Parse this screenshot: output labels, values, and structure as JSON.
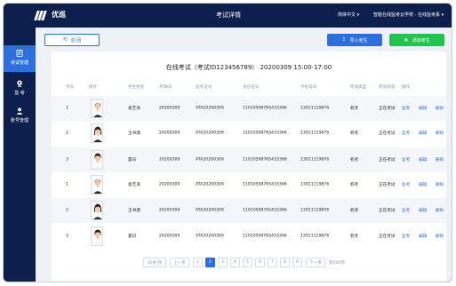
{
  "topbar": {
    "brand": "优巡",
    "page_title": "考试详情",
    "language": "简体中文 ▾",
    "school": "智能在线监考云学校 - 在线监考系 ▾"
  },
  "sidebar": {
    "items": [
      {
        "label": "考试管理",
        "icon": "document-icon"
      },
      {
        "label": "监 考",
        "icon": "monitor-icon"
      },
      {
        "label": "账号管理",
        "icon": "user-icon"
      }
    ]
  },
  "toolbar": {
    "back_label": "返 回",
    "import_label": "导入考生",
    "add_label": "添加考生"
  },
  "exam": {
    "title": "在线考试（考试ID123456789）  20200309 15:00-17:00"
  },
  "table": {
    "headers": [
      "序号",
      "照片",
      "考生姓名",
      "考场ID",
      "准考证号",
      "身份证号",
      "手机号码",
      "考试类型",
      "考试状态",
      "操作"
    ],
    "rows": [
      {
        "index": "1",
        "name": "袁艺泽",
        "room": "20200309",
        "ticket": "ATA20200309",
        "idcard": "11010598765433366",
        "phone": "13911119876",
        "type": "机考",
        "status": "正在考试",
        "photo": "male"
      },
      {
        "index": "2",
        "name": "王书潇",
        "room": "20200309",
        "ticket": "ATA20200309",
        "idcard": "11010598765433366",
        "phone": "13911119876",
        "type": "机考",
        "status": "正在考试",
        "photo": "female"
      },
      {
        "index": "3",
        "name": "夏日",
        "room": "20200309",
        "ticket": "ATA20200309",
        "idcard": "11010598765433366",
        "phone": "13911119876",
        "type": "机考",
        "status": "正在考试",
        "photo": "girl"
      },
      {
        "index": "1",
        "name": "袁艺泽",
        "room": "20200309",
        "ticket": "ATA20200309",
        "idcard": "11010598765433366",
        "phone": "13911119876",
        "type": "机考",
        "status": "正在考试",
        "photo": "male"
      },
      {
        "index": "2",
        "name": "王书潇",
        "room": "20200309",
        "ticket": "ATA20200309",
        "idcard": "11010598765433366",
        "phone": "13911119876",
        "type": "机考",
        "status": "正在考试",
        "photo": "female"
      },
      {
        "index": "3",
        "name": "夏日",
        "room": "20200309",
        "ticket": "ATA20200309",
        "idcard": "11010598765433366",
        "phone": "13911119876",
        "type": "机考",
        "status": "正在考试",
        "photo": "girl"
      }
    ],
    "actions": {
      "proctor": "监考",
      "edit": "编辑",
      "delete": "删除"
    }
  },
  "pagination": {
    "page_size": "20条/页",
    "prev": "上一页",
    "pages": [
      "1",
      "2",
      "3",
      "4",
      "5",
      "6",
      "7",
      "8",
      "9"
    ],
    "current": "2",
    "next": "下一页",
    "jump": "到200页"
  },
  "colors": {
    "nav_bg": "#0d1f4c",
    "accent": "#2e6fe0",
    "add_green": "#21c44f"
  }
}
